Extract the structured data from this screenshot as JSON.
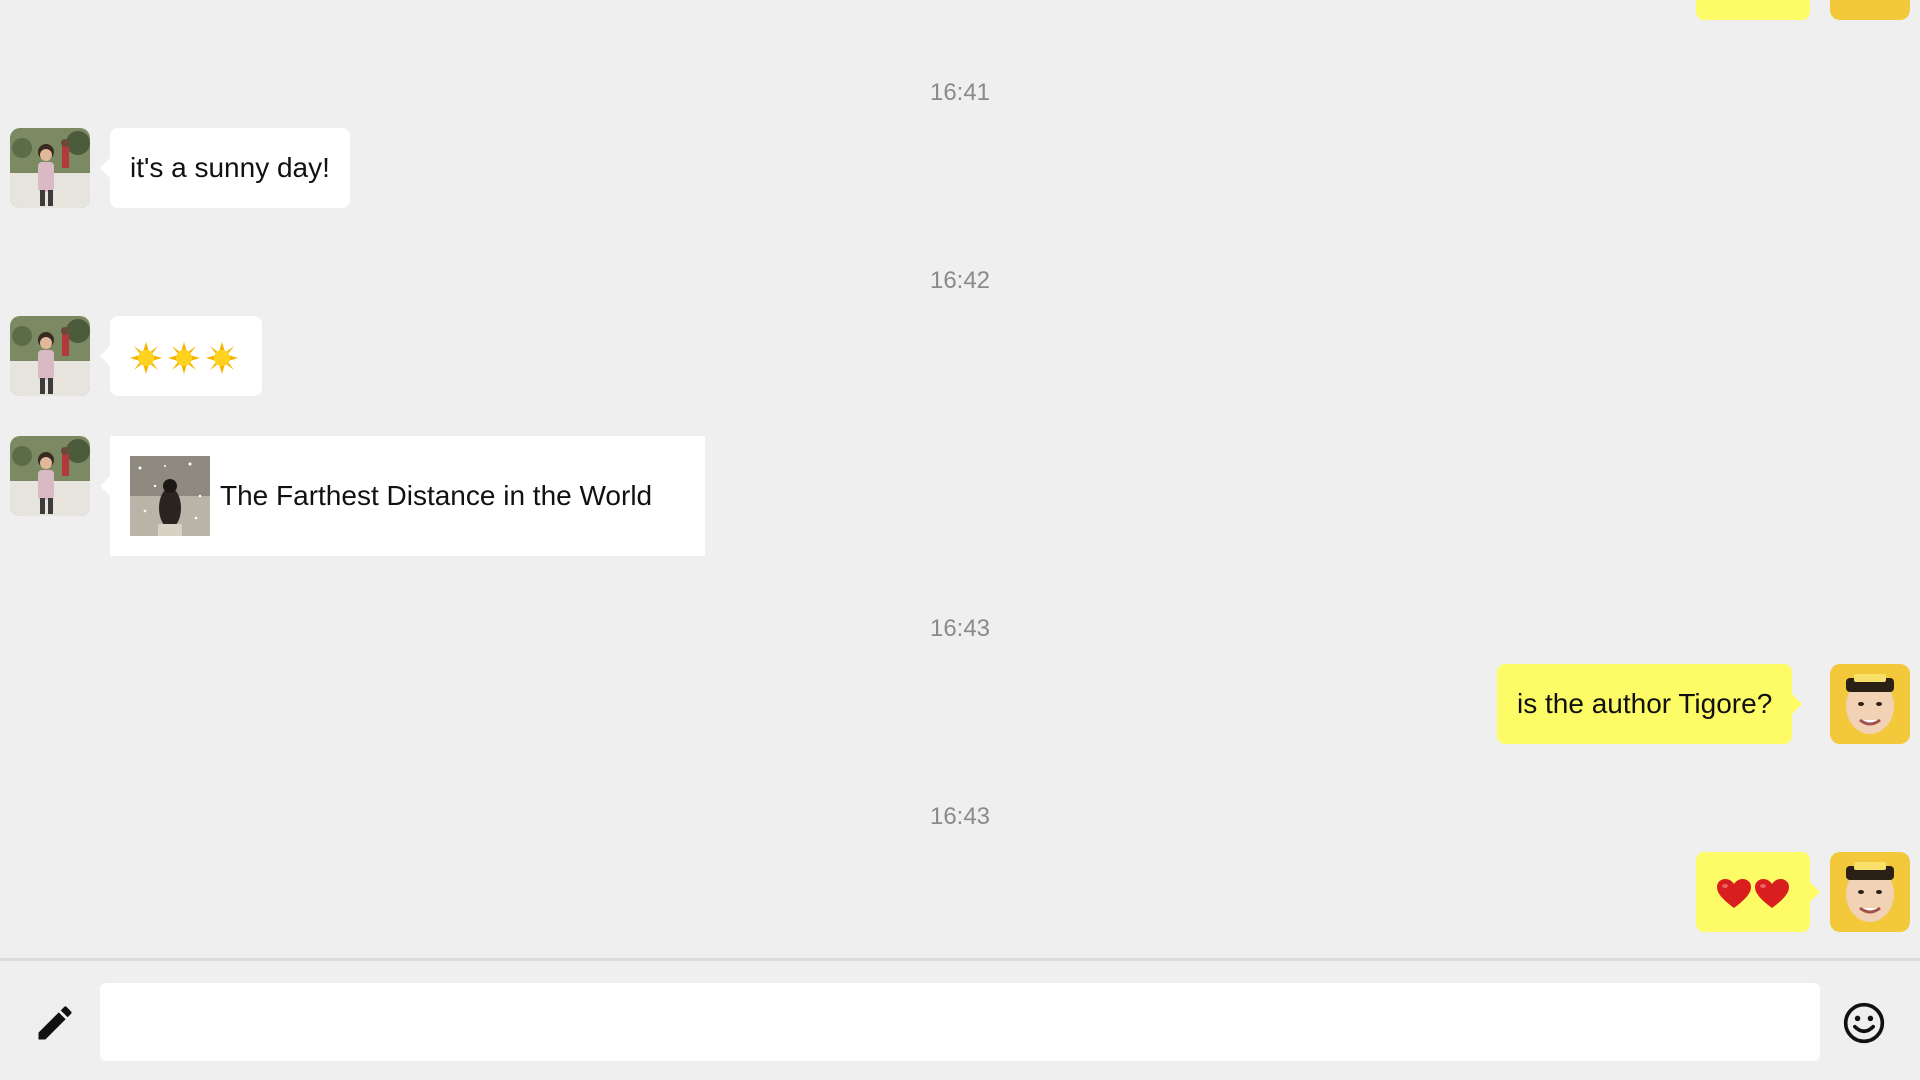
{
  "messages": [
    {
      "time": "16:41",
      "from": "other",
      "kind": "text",
      "text": "it's a sunny day!"
    },
    {
      "time": "16:42",
      "from": "other",
      "kind": "emoji",
      "emoji": [
        "sun-emoji",
        "sun-emoji",
        "sun-emoji"
      ]
    },
    {
      "from": "other",
      "kind": "link-card",
      "title": "The Farthest Distance in the World"
    },
    {
      "time": "16:43",
      "from": "me",
      "kind": "text",
      "text": "is the author Tigore?"
    },
    {
      "time": "16:43",
      "from": "me",
      "kind": "emoji",
      "emoji": [
        "heart-emoji",
        "heart-emoji"
      ]
    }
  ],
  "input": {
    "value": "",
    "placeholder": "",
    "left_icon": "pencil-icon",
    "right_icon": "smiley-icon"
  },
  "colors": {
    "background": "#efefef",
    "incoming_bubble": "#ffffff",
    "outgoing_bubble": "#fdfc67",
    "timestamp": "#8a8a8a"
  }
}
